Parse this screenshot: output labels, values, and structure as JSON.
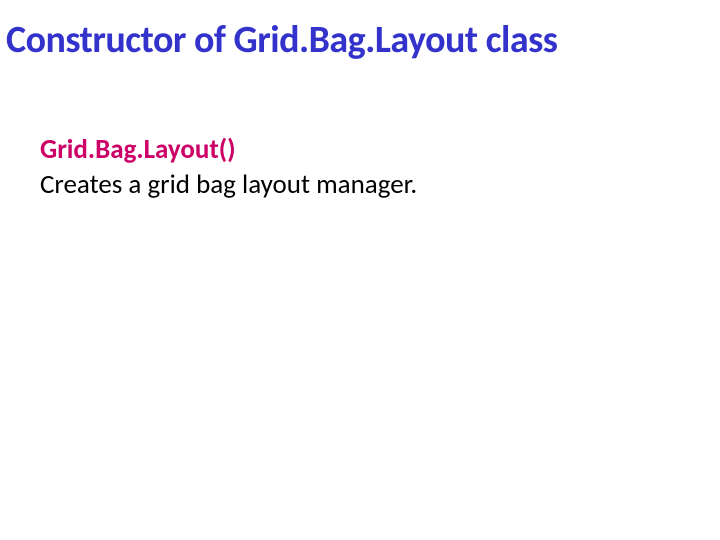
{
  "title": "Constructor of Grid.Bag.Layout class",
  "constructor_name": "Grid.Bag.Layout()",
  "description": "Creates a grid bag layout manager."
}
